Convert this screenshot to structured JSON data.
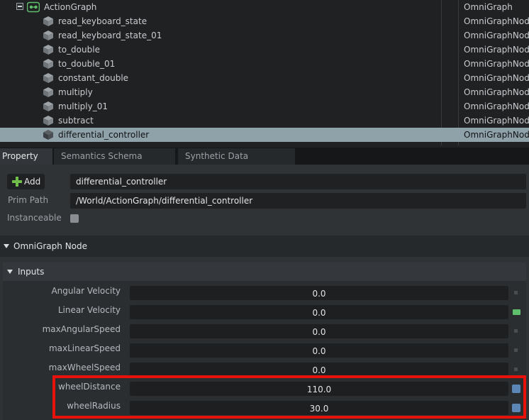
{
  "stage_tree": {
    "root": {
      "name": "ActionGraph",
      "type": "OmniGraph"
    },
    "children": [
      {
        "name": "read_keyboard_state",
        "type": "OmniGraphNode"
      },
      {
        "name": "read_keyboard_state_01",
        "type": "OmniGraphNode"
      },
      {
        "name": "to_double",
        "type": "OmniGraphNode"
      },
      {
        "name": "to_double_01",
        "type": "OmniGraphNode"
      },
      {
        "name": "constant_double",
        "type": "OmniGraphNode"
      },
      {
        "name": "multiply",
        "type": "OmniGraphNode"
      },
      {
        "name": "multiply_01",
        "type": "OmniGraphNode"
      },
      {
        "name": "subtract",
        "type": "OmniGraphNode"
      },
      {
        "name": "differential_controller",
        "type": "OmniGraphNode"
      }
    ]
  },
  "tabs": [
    "Property",
    "Semantics Schema Editor",
    "Synthetic Data Recorder"
  ],
  "property": {
    "add_label": "Add",
    "name_value": "differential_controller",
    "prim_path_label": "Prim Path",
    "prim_path_value": "/World/ActionGraph/differential_controller",
    "instanceable_label": "Instanceable",
    "section_title": "OmniGraph Node",
    "inputs_title": "Inputs",
    "inputs": [
      {
        "label": "Angular Velocity",
        "value": "0.0"
      },
      {
        "label": "Linear Velocity",
        "value": "0.0"
      },
      {
        "label": "maxAngularSpeed",
        "value": "0.0"
      },
      {
        "label": "maxLinearSpeed",
        "value": "0.0"
      },
      {
        "label": "maxWheelSpeed",
        "value": "0.0"
      },
      {
        "label": "wheelDistance",
        "value": "110.0"
      },
      {
        "label": "wheelRadius",
        "value": "30.0"
      }
    ]
  },
  "colors": {
    "highlight": "#e8120c",
    "selection": "#8fa1a9",
    "connected": "#5fbf6a",
    "authored": "#5b86b5"
  }
}
